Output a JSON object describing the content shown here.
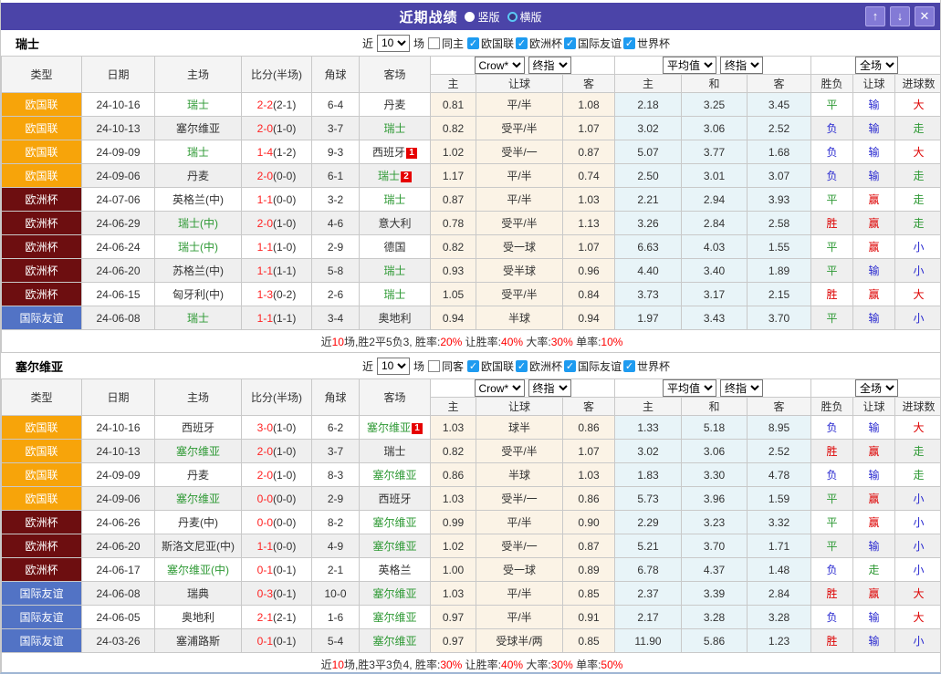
{
  "titlebar": {
    "title": "近期战绩",
    "vertical_label": "竖版",
    "horizontal_label": "横版",
    "selected": "竖版",
    "up_icon": "↑",
    "down_icon": "↓",
    "close_icon": "✕"
  },
  "labels": {
    "recent": "近",
    "games": "场",
    "leagues": [
      "欧国联",
      "欧洲杯",
      "国际友谊",
      "世界杯"
    ]
  },
  "columns": {
    "type": "类型",
    "date": "日期",
    "home": "主场",
    "score": "比分(半场)",
    "corner": "角球",
    "away": "客场",
    "provider1": "Crow*",
    "time1": "终指",
    "provider2": "平均值",
    "time2": "终指",
    "scope": "全场",
    "sub": [
      "主",
      "让球",
      "客",
      "主",
      "和",
      "客",
      "胜负",
      "让球",
      "进球数"
    ]
  },
  "colors": {
    "titlebar_bg": "#4B44A8",
    "league": {
      "欧国联": "#F7A40A",
      "欧洲杯": "#6D0E10",
      "国际友谊": "#5273C5"
    },
    "team_green": "#2E9934",
    "score_red": "#FF2222",
    "result": {
      "胜": "#DD0000",
      "赢": "#DD0000",
      "大": "#DD0000",
      "平": "#2E9934",
      "走": "#2E9934",
      "负": "#2A2AD0",
      "输": "#2A2AD0",
      "小": "#2A2AD0"
    },
    "summary_red": "#FF0000",
    "handicap_bg": "#FBF3E6",
    "average_bg": "#E8F4F8"
  },
  "sections": [
    {
      "team": "瑞士",
      "recent_count": "10",
      "same_label": "同主",
      "rows": [
        {
          "league": "欧国联",
          "date": "24-10-16",
          "home": "瑞士",
          "home_is_team": true,
          "home_badge": "",
          "score": "2-2",
          "half": "(2-1)",
          "corner": "6-4",
          "away": "丹麦",
          "away_is_team": false,
          "away_badge": "",
          "odds_home": "0.81",
          "handicap": "平/半",
          "odds_away": "1.08",
          "avg_home": "2.18",
          "avg_draw": "3.25",
          "avg_away": "3.45",
          "result_wdl": "平",
          "result_handicap": "输",
          "result_goals": "大"
        },
        {
          "league": "欧国联",
          "date": "24-10-13",
          "home": "塞尔维亚",
          "home_is_team": false,
          "home_badge": "",
          "score": "2-0",
          "half": "(1-0)",
          "corner": "3-7",
          "away": "瑞士",
          "away_is_team": true,
          "away_badge": "",
          "odds_home": "0.82",
          "handicap": "受平/半",
          "odds_away": "1.07",
          "avg_home": "3.02",
          "avg_draw": "3.06",
          "avg_away": "2.52",
          "result_wdl": "负",
          "result_handicap": "输",
          "result_goals": "走"
        },
        {
          "league": "欧国联",
          "date": "24-09-09",
          "home": "瑞士",
          "home_is_team": true,
          "home_badge": "",
          "score": "1-4",
          "half": "(1-2)",
          "corner": "9-3",
          "away": "西班牙",
          "away_is_team": false,
          "away_badge": "1",
          "odds_home": "1.02",
          "handicap": "受半/一",
          "odds_away": "0.87",
          "avg_home": "5.07",
          "avg_draw": "3.77",
          "avg_away": "1.68",
          "result_wdl": "负",
          "result_handicap": "输",
          "result_goals": "大"
        },
        {
          "league": "欧国联",
          "date": "24-09-06",
          "home": "丹麦",
          "home_is_team": false,
          "home_badge": "",
          "score": "2-0",
          "half": "(0-0)",
          "corner": "6-1",
          "away": "瑞士",
          "away_is_team": true,
          "away_badge": "2",
          "odds_home": "1.17",
          "handicap": "平/半",
          "odds_away": "0.74",
          "avg_home": "2.50",
          "avg_draw": "3.01",
          "avg_away": "3.07",
          "result_wdl": "负",
          "result_handicap": "输",
          "result_goals": "走"
        },
        {
          "league": "欧洲杯",
          "date": "24-07-06",
          "home": "英格兰(中)",
          "home_is_team": false,
          "home_badge": "",
          "score": "1-1",
          "half": "(0-0)",
          "corner": "3-2",
          "away": "瑞士",
          "away_is_team": true,
          "away_badge": "",
          "odds_home": "0.87",
          "handicap": "平/半",
          "odds_away": "1.03",
          "avg_home": "2.21",
          "avg_draw": "2.94",
          "avg_away": "3.93",
          "result_wdl": "平",
          "result_handicap": "赢",
          "result_goals": "走"
        },
        {
          "league": "欧洲杯",
          "date": "24-06-29",
          "home": "瑞士(中)",
          "home_is_team": true,
          "home_badge": "",
          "score": "2-0",
          "half": "(1-0)",
          "corner": "4-6",
          "away": "意大利",
          "away_is_team": false,
          "away_badge": "",
          "odds_home": "0.78",
          "handicap": "受平/半",
          "odds_away": "1.13",
          "avg_home": "3.26",
          "avg_draw": "2.84",
          "avg_away": "2.58",
          "result_wdl": "胜",
          "result_handicap": "赢",
          "result_goals": "走"
        },
        {
          "league": "欧洲杯",
          "date": "24-06-24",
          "home": "瑞士(中)",
          "home_is_team": true,
          "home_badge": "",
          "score": "1-1",
          "half": "(1-0)",
          "corner": "2-9",
          "away": "德国",
          "away_is_team": false,
          "away_badge": "",
          "odds_home": "0.82",
          "handicap": "受一球",
          "odds_away": "1.07",
          "avg_home": "6.63",
          "avg_draw": "4.03",
          "avg_away": "1.55",
          "result_wdl": "平",
          "result_handicap": "赢",
          "result_goals": "小"
        },
        {
          "league": "欧洲杯",
          "date": "24-06-20",
          "home": "苏格兰(中)",
          "home_is_team": false,
          "home_badge": "",
          "score": "1-1",
          "half": "(1-1)",
          "corner": "5-8",
          "away": "瑞士",
          "away_is_team": true,
          "away_badge": "",
          "odds_home": "0.93",
          "handicap": "受半球",
          "odds_away": "0.96",
          "avg_home": "4.40",
          "avg_draw": "3.40",
          "avg_away": "1.89",
          "result_wdl": "平",
          "result_handicap": "输",
          "result_goals": "小"
        },
        {
          "league": "欧洲杯",
          "date": "24-06-15",
          "home": "匈牙利(中)",
          "home_is_team": false,
          "home_badge": "",
          "score": "1-3",
          "half": "(0-2)",
          "corner": "2-6",
          "away": "瑞士",
          "away_is_team": true,
          "away_badge": "",
          "odds_home": "1.05",
          "handicap": "受平/半",
          "odds_away": "0.84",
          "avg_home": "3.73",
          "avg_draw": "3.17",
          "avg_away": "2.15",
          "result_wdl": "胜",
          "result_handicap": "赢",
          "result_goals": "大"
        },
        {
          "league": "国际友谊",
          "date": "24-06-08",
          "home": "瑞士",
          "home_is_team": true,
          "home_badge": "",
          "score": "1-1",
          "half": "(1-1)",
          "corner": "3-4",
          "away": "奥地利",
          "away_is_team": false,
          "away_badge": "",
          "odds_home": "0.94",
          "handicap": "半球",
          "odds_away": "0.94",
          "avg_home": "1.97",
          "avg_draw": "3.43",
          "avg_away": "3.70",
          "result_wdl": "平",
          "result_handicap": "输",
          "result_goals": "小"
        }
      ],
      "summary": [
        {
          "t": "近"
        },
        {
          "t": "10",
          "red": true
        },
        {
          "t": "场,胜2平5负3, 胜率:"
        },
        {
          "t": "20%",
          "red": true
        },
        {
          "t": " 让胜率:"
        },
        {
          "t": "40%",
          "red": true
        },
        {
          "t": " 大率:"
        },
        {
          "t": "30%",
          "red": true
        },
        {
          "t": " 单率:"
        },
        {
          "t": "10%",
          "red": true
        }
      ]
    },
    {
      "team": "塞尔维亚",
      "recent_count": "10",
      "same_label": "同客",
      "rows": [
        {
          "league": "欧国联",
          "date": "24-10-16",
          "home": "西班牙",
          "home_is_team": false,
          "home_badge": "",
          "score": "3-0",
          "half": "(1-0)",
          "corner": "6-2",
          "away": "塞尔维亚",
          "away_is_team": true,
          "away_badge": "1",
          "odds_home": "1.03",
          "handicap": "球半",
          "odds_away": "0.86",
          "avg_home": "1.33",
          "avg_draw": "5.18",
          "avg_away": "8.95",
          "result_wdl": "负",
          "result_handicap": "输",
          "result_goals": "大"
        },
        {
          "league": "欧国联",
          "date": "24-10-13",
          "home": "塞尔维亚",
          "home_is_team": true,
          "home_badge": "",
          "score": "2-0",
          "half": "(1-0)",
          "corner": "3-7",
          "away": "瑞士",
          "away_is_team": false,
          "away_badge": "",
          "odds_home": "0.82",
          "handicap": "受平/半",
          "odds_away": "1.07",
          "avg_home": "3.02",
          "avg_draw": "3.06",
          "avg_away": "2.52",
          "result_wdl": "胜",
          "result_handicap": "赢",
          "result_goals": "走"
        },
        {
          "league": "欧国联",
          "date": "24-09-09",
          "home": "丹麦",
          "home_is_team": false,
          "home_badge": "",
          "score": "2-0",
          "half": "(1-0)",
          "corner": "8-3",
          "away": "塞尔维亚",
          "away_is_team": true,
          "away_badge": "",
          "odds_home": "0.86",
          "handicap": "半球",
          "odds_away": "1.03",
          "avg_home": "1.83",
          "avg_draw": "3.30",
          "avg_away": "4.78",
          "result_wdl": "负",
          "result_handicap": "输",
          "result_goals": "走"
        },
        {
          "league": "欧国联",
          "date": "24-09-06",
          "home": "塞尔维亚",
          "home_is_team": true,
          "home_badge": "",
          "score": "0-0",
          "half": "(0-0)",
          "corner": "2-9",
          "away": "西班牙",
          "away_is_team": false,
          "away_badge": "",
          "odds_home": "1.03",
          "handicap": "受半/一",
          "odds_away": "0.86",
          "avg_home": "5.73",
          "avg_draw": "3.96",
          "avg_away": "1.59",
          "result_wdl": "平",
          "result_handicap": "赢",
          "result_goals": "小"
        },
        {
          "league": "欧洲杯",
          "date": "24-06-26",
          "home": "丹麦(中)",
          "home_is_team": false,
          "home_badge": "",
          "score": "0-0",
          "half": "(0-0)",
          "corner": "8-2",
          "away": "塞尔维亚",
          "away_is_team": true,
          "away_badge": "",
          "odds_home": "0.99",
          "handicap": "平/半",
          "odds_away": "0.90",
          "avg_home": "2.29",
          "avg_draw": "3.23",
          "avg_away": "3.32",
          "result_wdl": "平",
          "result_handicap": "赢",
          "result_goals": "小"
        },
        {
          "league": "欧洲杯",
          "date": "24-06-20",
          "home": "斯洛文尼亚(中)",
          "home_is_team": false,
          "home_badge": "",
          "score": "1-1",
          "half": "(0-0)",
          "corner": "4-9",
          "away": "塞尔维亚",
          "away_is_team": true,
          "away_badge": "",
          "odds_home": "1.02",
          "handicap": "受半/一",
          "odds_away": "0.87",
          "avg_home": "5.21",
          "avg_draw": "3.70",
          "avg_away": "1.71",
          "result_wdl": "平",
          "result_handicap": "输",
          "result_goals": "小"
        },
        {
          "league": "欧洲杯",
          "date": "24-06-17",
          "home": "塞尔维亚(中)",
          "home_is_team": true,
          "home_badge": "",
          "score": "0-1",
          "half": "(0-1)",
          "corner": "2-1",
          "away": "英格兰",
          "away_is_team": false,
          "away_badge": "",
          "odds_home": "1.00",
          "handicap": "受一球",
          "odds_away": "0.89",
          "avg_home": "6.78",
          "avg_draw": "4.37",
          "avg_away": "1.48",
          "result_wdl": "负",
          "result_handicap": "走",
          "result_goals": "小"
        },
        {
          "league": "国际友谊",
          "date": "24-06-08",
          "home": "瑞典",
          "home_is_team": false,
          "home_badge": "",
          "score": "0-3",
          "half": "(0-1)",
          "corner": "10-0",
          "away": "塞尔维亚",
          "away_is_team": true,
          "away_badge": "",
          "odds_home": "1.03",
          "handicap": "平/半",
          "odds_away": "0.85",
          "avg_home": "2.37",
          "avg_draw": "3.39",
          "avg_away": "2.84",
          "result_wdl": "胜",
          "result_handicap": "赢",
          "result_goals": "大"
        },
        {
          "league": "国际友谊",
          "date": "24-06-05",
          "home": "奥地利",
          "home_is_team": false,
          "home_badge": "",
          "score": "2-1",
          "half": "(2-1)",
          "corner": "1-6",
          "away": "塞尔维亚",
          "away_is_team": true,
          "away_badge": "",
          "odds_home": "0.97",
          "handicap": "平/半",
          "odds_away": "0.91",
          "avg_home": "2.17",
          "avg_draw": "3.28",
          "avg_away": "3.28",
          "result_wdl": "负",
          "result_handicap": "输",
          "result_goals": "大"
        },
        {
          "league": "国际友谊",
          "date": "24-03-26",
          "home": "塞浦路斯",
          "home_is_team": false,
          "home_badge": "",
          "score": "0-1",
          "half": "(0-1)",
          "corner": "5-4",
          "away": "塞尔维亚",
          "away_is_team": true,
          "away_badge": "",
          "odds_home": "0.97",
          "handicap": "受球半/两",
          "odds_away": "0.85",
          "avg_home": "11.90",
          "avg_draw": "5.86",
          "avg_away": "1.23",
          "result_wdl": "胜",
          "result_handicap": "输",
          "result_goals": "小"
        }
      ],
      "summary": [
        {
          "t": "近"
        },
        {
          "t": "10",
          "red": true
        },
        {
          "t": "场,胜3平3负4, 胜率:"
        },
        {
          "t": "30%",
          "red": true
        },
        {
          "t": " 让胜率:"
        },
        {
          "t": "40%",
          "red": true
        },
        {
          "t": " 大率:"
        },
        {
          "t": "30%",
          "red": true
        },
        {
          "t": " 单率:"
        },
        {
          "t": "50%",
          "red": true
        }
      ]
    }
  ]
}
